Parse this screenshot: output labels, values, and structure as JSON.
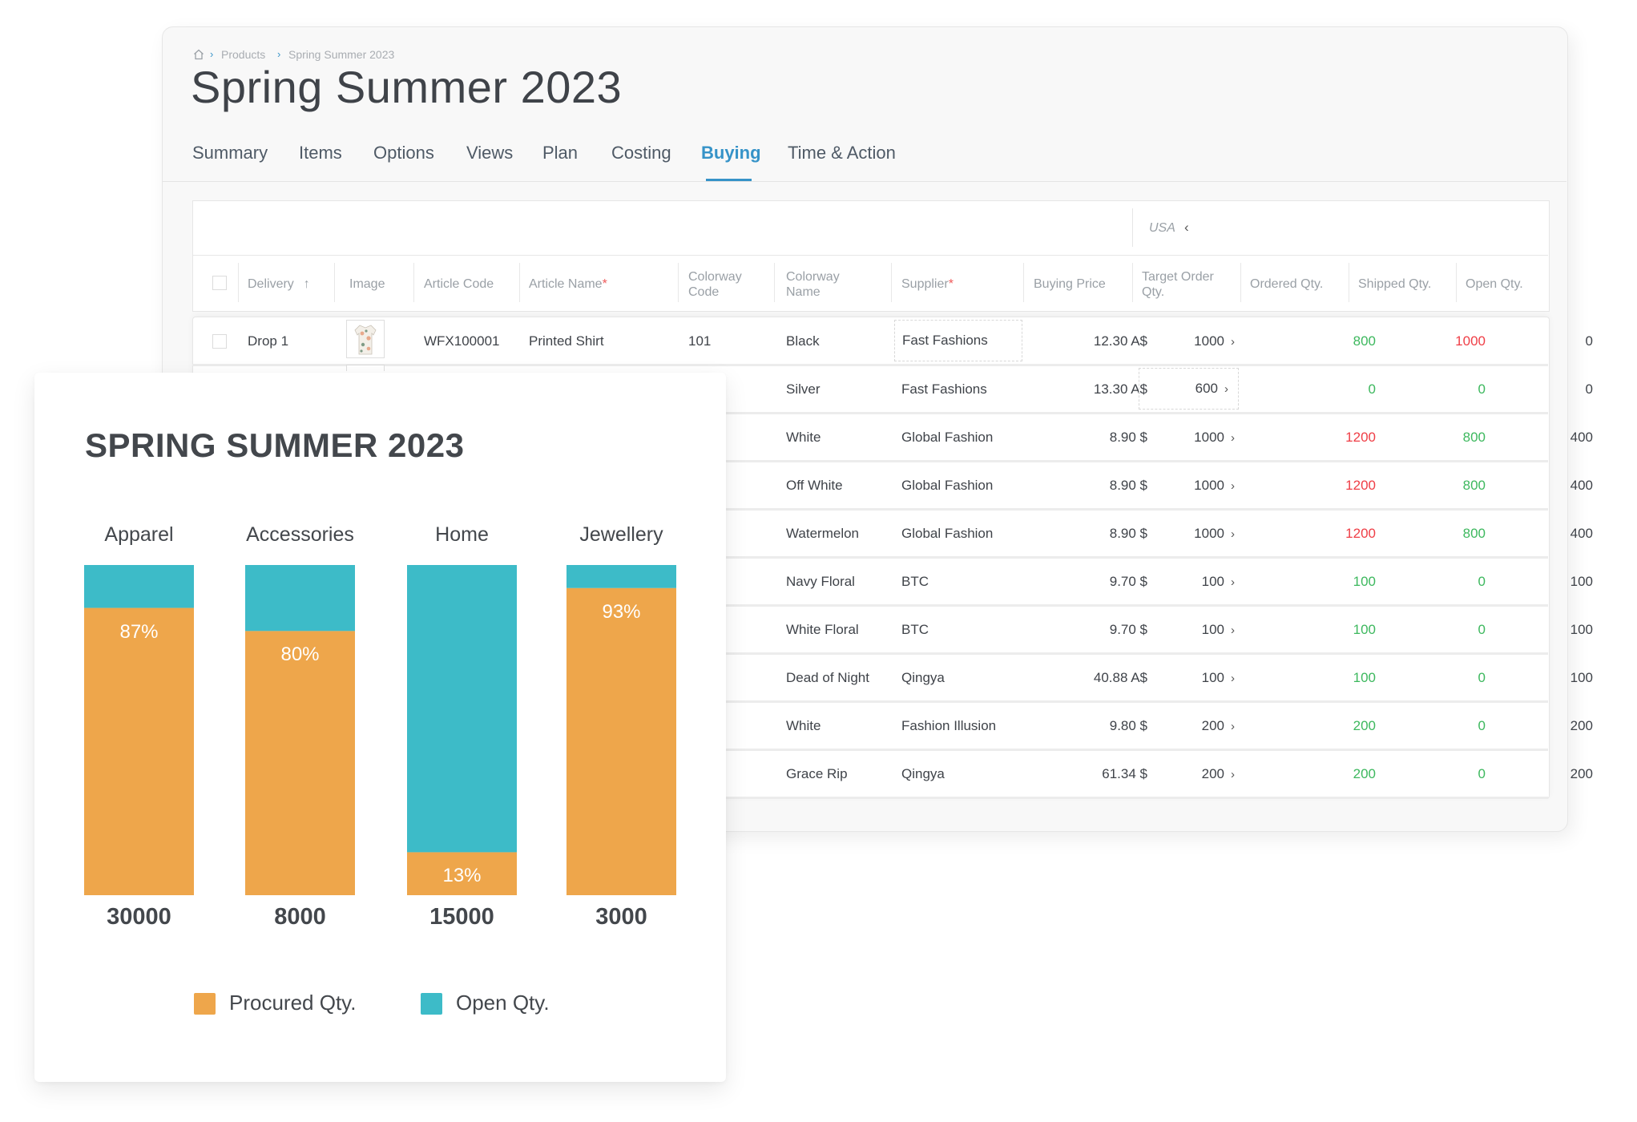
{
  "breadcrumb": {
    "home_icon": "home-icon",
    "items": [
      "Products",
      "Spring Summer 2023"
    ]
  },
  "page_title": "Spring Summer 2023",
  "tabs": [
    {
      "label": "Summary"
    },
    {
      "label": "Items"
    },
    {
      "label": "Options"
    },
    {
      "label": "Views"
    },
    {
      "label": "Plan"
    },
    {
      "label": "Costing"
    },
    {
      "label": "Buying",
      "active": true
    },
    {
      "label": "Time & Action"
    }
  ],
  "table": {
    "group_header": "USA",
    "columns": {
      "delivery": "Delivery",
      "image": "Image",
      "article_code": "Article Code",
      "article_name": "Article Name",
      "colorway_code_1": "Colorway",
      "colorway_code_2": "Code",
      "colorway_name_1": "Colorway",
      "colorway_name_2": "Name",
      "supplier": "Supplier",
      "buying_price": "Buying Price",
      "target_order_1": "Target Order",
      "target_order_2": "Qty.",
      "ordered_qty": "Ordered Qty.",
      "shipped_qty": "Shipped Qty.",
      "open_qty": "Open Qty.",
      "required_mark": "*"
    },
    "rows": [
      {
        "delivery": "Drop 1",
        "article_code": "WFX100001",
        "article_name": "Printed Shirt",
        "colorway_code": "101",
        "colorway_name": "Black",
        "supplier": "Fast Fashions",
        "buying_price": "12.30 A$",
        "target_order": "1000",
        "ordered": "800",
        "ordered_status": "green",
        "shipped": "1000",
        "shipped_status": "red",
        "open": "0"
      },
      {
        "delivery": "",
        "article_code": "",
        "article_name": "",
        "colorway_code": "",
        "colorway_name": "Silver",
        "supplier": "Fast Fashions",
        "buying_price": "13.30 A$",
        "target_order": "600",
        "ordered": "0",
        "ordered_status": "green",
        "shipped": "0",
        "shipped_status": "green",
        "open": "0"
      },
      {
        "colorway_name": "White",
        "supplier": "Global Fashion",
        "buying_price": "8.90 $",
        "target_order": "1000",
        "ordered": "1200",
        "ordered_status": "red",
        "shipped": "800",
        "shipped_status": "green",
        "open": "400"
      },
      {
        "colorway_name": "Off White",
        "supplier": "Global Fashion",
        "buying_price": "8.90 $",
        "target_order": "1000",
        "ordered": "1200",
        "ordered_status": "red",
        "shipped": "800",
        "shipped_status": "green",
        "open": "400"
      },
      {
        "colorway_name": "Watermelon",
        "supplier": "Global Fashion",
        "buying_price": "8.90 $",
        "target_order": "1000",
        "ordered": "1200",
        "ordered_status": "red",
        "shipped": "800",
        "shipped_status": "green",
        "open": "400"
      },
      {
        "colorway_name": "Navy Floral",
        "supplier": "BTC",
        "buying_price": "9.70 $",
        "target_order": "100",
        "ordered": "100",
        "ordered_status": "green",
        "shipped": "0",
        "shipped_status": "green",
        "open": "100"
      },
      {
        "colorway_name": "White Floral",
        "supplier": "BTC",
        "buying_price": "9.70 $",
        "target_order": "100",
        "ordered": "100",
        "ordered_status": "green",
        "shipped": "0",
        "shipped_status": "green",
        "open": "100"
      },
      {
        "colorway_name": "Dead of Night",
        "supplier": "Qingya",
        "buying_price": "40.88 A$",
        "target_order": "100",
        "ordered": "100",
        "ordered_status": "green",
        "shipped": "0",
        "shipped_status": "green",
        "open": "100"
      },
      {
        "colorway_name": "White",
        "supplier": "Fashion Illusion",
        "buying_price": "9.80 $",
        "target_order": "200",
        "ordered": "200",
        "ordered_status": "green",
        "shipped": "0",
        "shipped_status": "green",
        "open": "200"
      },
      {
        "colorway_name": "Grace Rip",
        "supplier": "Qingya",
        "buying_price": "61.34 $",
        "target_order": "200",
        "ordered": "200",
        "ordered_status": "green",
        "shipped": "0",
        "shipped_status": "green",
        "open": "200"
      }
    ]
  },
  "colors": {
    "accent": "#3693c8",
    "procured": "#eea64b",
    "open": "#3dbbc8",
    "status_green": "#3db85e",
    "status_red": "#ef3e46"
  },
  "chart_data": {
    "type": "bar",
    "stacked": true,
    "normalized": true,
    "title": "SPRING SUMMER 2023",
    "categories": [
      "Apparel",
      "Accessories",
      "Home",
      "Jewellery"
    ],
    "totals": [
      "30000",
      "8000",
      "15000",
      "3000"
    ],
    "series": [
      {
        "name": "Procured Qty.",
        "values": [
          87,
          80,
          13,
          93
        ],
        "labels": [
          "87%",
          "80%",
          "13%",
          "93%"
        ],
        "color": "#eea64b"
      },
      {
        "name": "Open Qty.",
        "values": [
          13,
          20,
          87,
          7
        ],
        "color": "#3dbbc8"
      }
    ],
    "ylim": [
      0,
      100
    ],
    "legend": "bottom-center",
    "grid": false
  }
}
